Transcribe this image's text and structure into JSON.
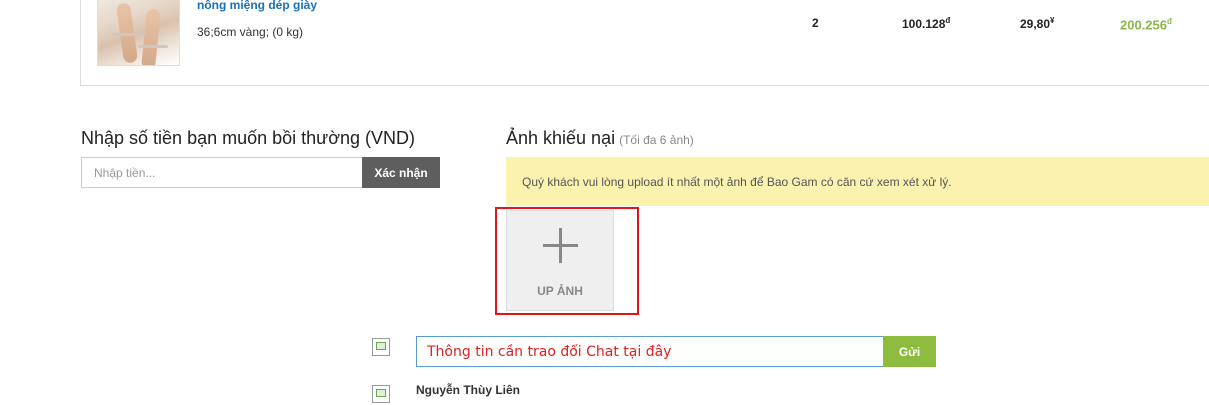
{
  "product": {
    "name": "nông miệng dép giày",
    "variant": "36;6cm vàng; (0 kg)",
    "quantity": "2",
    "unit_price": "100.128",
    "unit_price_currency": "đ",
    "cny_price": "29,80",
    "cny_currency": "¥",
    "total": "200.256",
    "total_currency": "đ"
  },
  "compensation": {
    "title": "Nhập số tiền bạn muốn bồi thường (VND)",
    "placeholder": "Nhập tiền...",
    "confirm_label": "Xác nhận"
  },
  "complaint_images": {
    "title": "Ảnh khiếu nại",
    "subtitle": "(Tối đa 6 ảnh)",
    "notice": "Quý khách vui lòng upload ít nhất một ảnh để Bao Gam có căn cứ xem xét xử lý.",
    "upload_label": "UP ẢNH"
  },
  "chat": {
    "placeholder": "Thông tin cần trao đổi Chat tại đây",
    "send_label": "Gửi",
    "last_sender": "Nguyễn Thùy Liên"
  },
  "colors": {
    "link": "#1a6fb8",
    "total": "#8bb44a",
    "notice_bg": "#fcf2b0",
    "highlight": "#e1141a",
    "send_button": "#8dbb3e",
    "confirm_button": "#5e5e5e"
  }
}
